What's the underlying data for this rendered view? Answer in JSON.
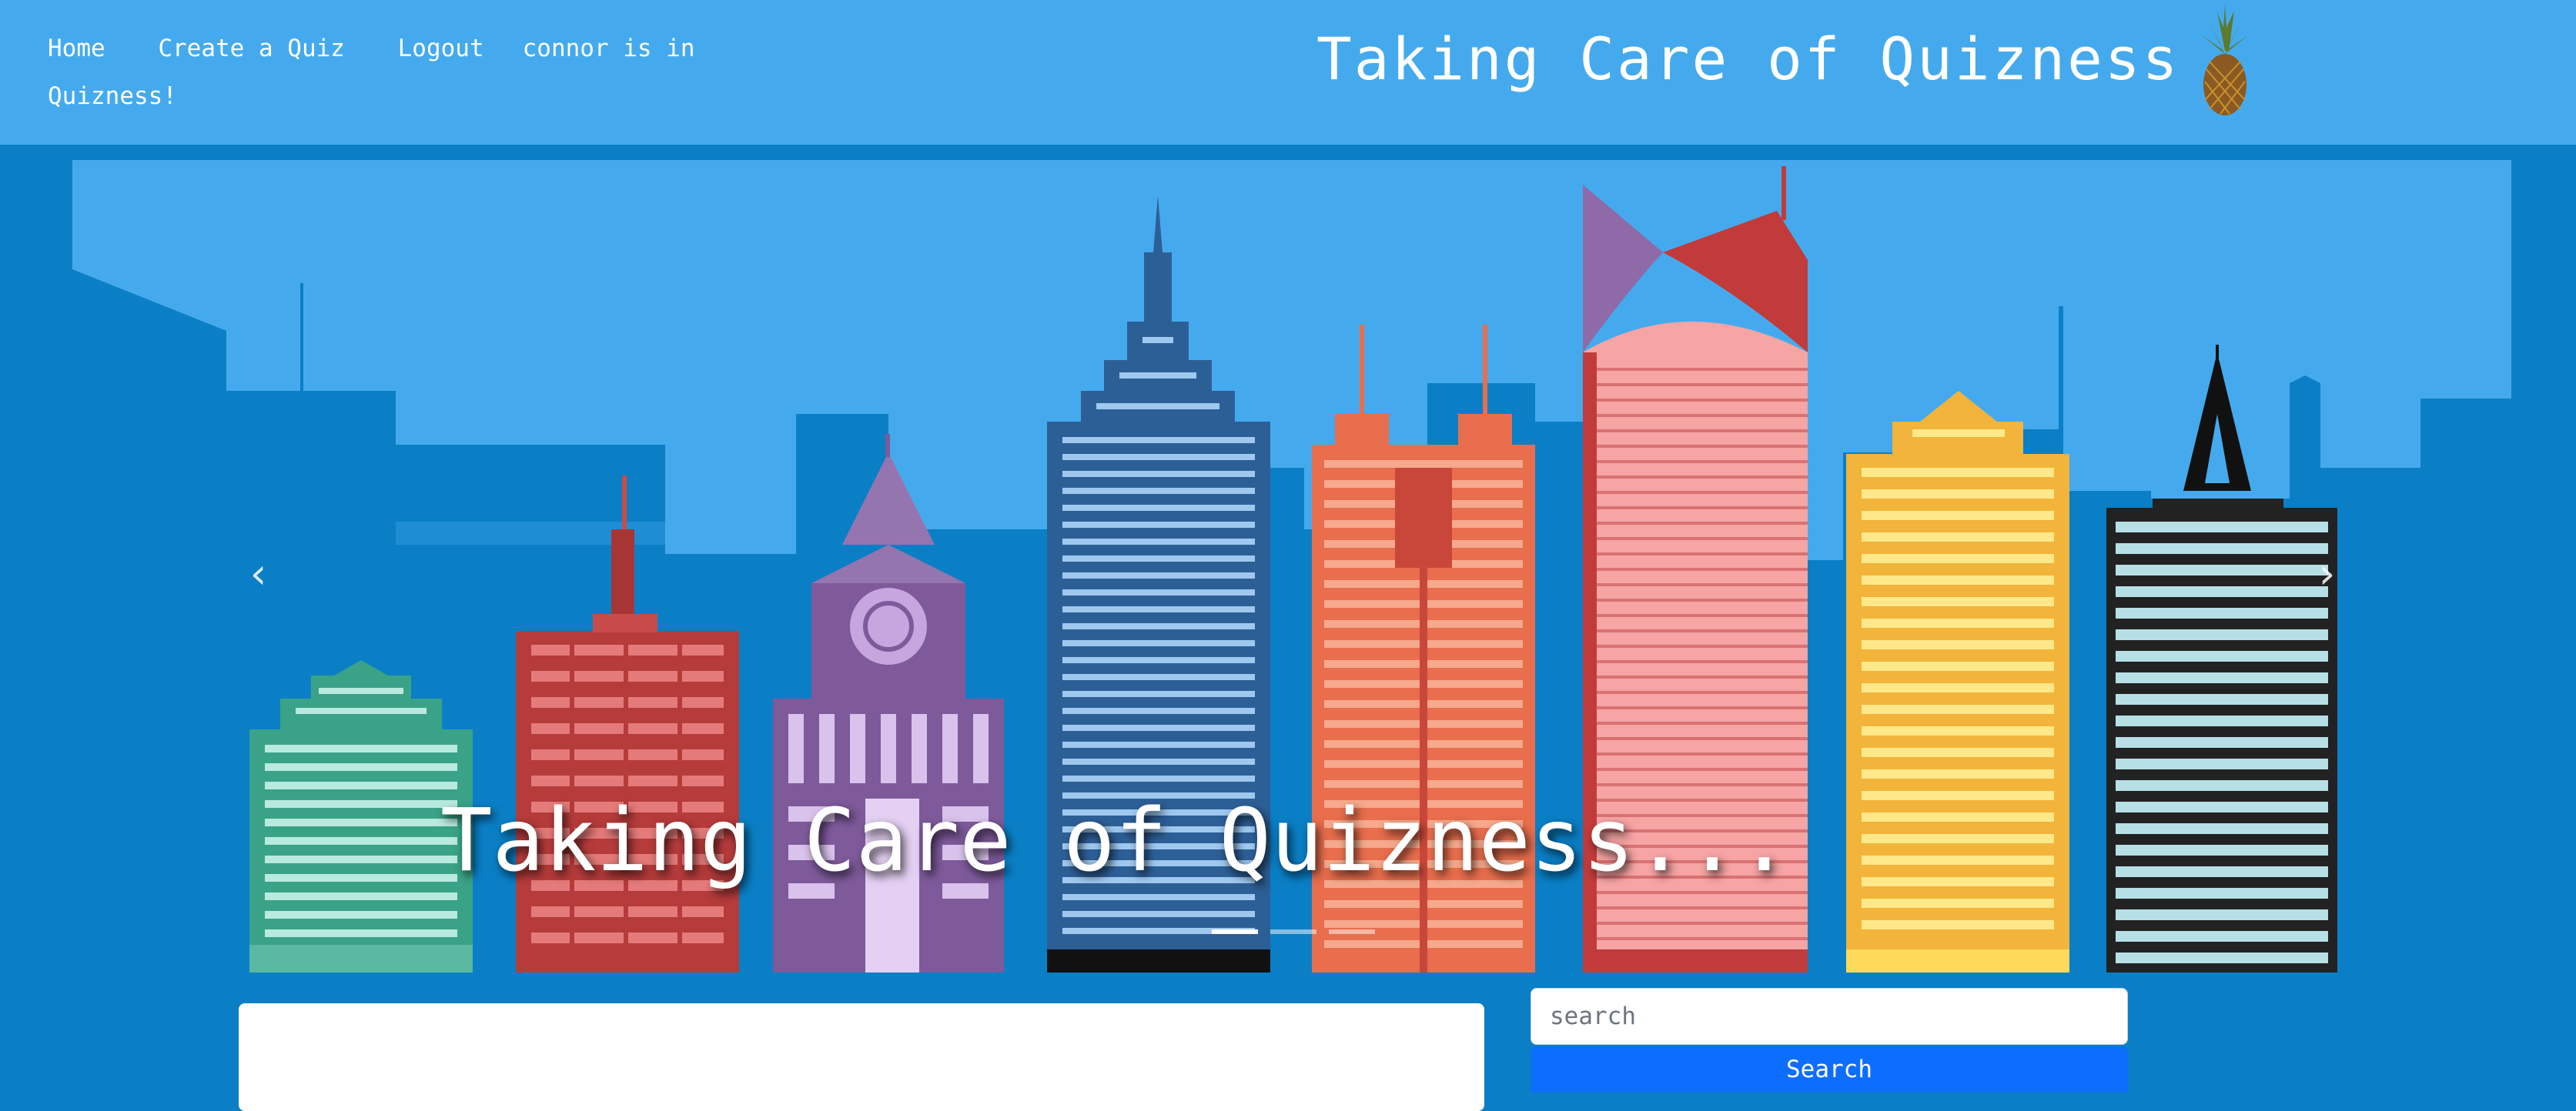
{
  "navbar": {
    "links": [
      "Home",
      "Create a Quiz",
      "Logout"
    ],
    "status_text": "connor is in Quizness!",
    "site_title": "Taking Care of Quizness",
    "logo_icon": "pineapple-icon"
  },
  "carousel": {
    "caption": "Taking Care of Quizness...",
    "prev_icon": "chevron-left-icon",
    "next_icon": "chevron-right-icon",
    "prev_glyph": "‹",
    "next_glyph": "›",
    "slide_count": 3,
    "active_slide": 1
  },
  "search": {
    "placeholder": "search",
    "button_label": "Search"
  },
  "colors": {
    "navbar": "#45aaed",
    "page_background": "#0a7fc6",
    "search_button": "#0d6efd"
  }
}
